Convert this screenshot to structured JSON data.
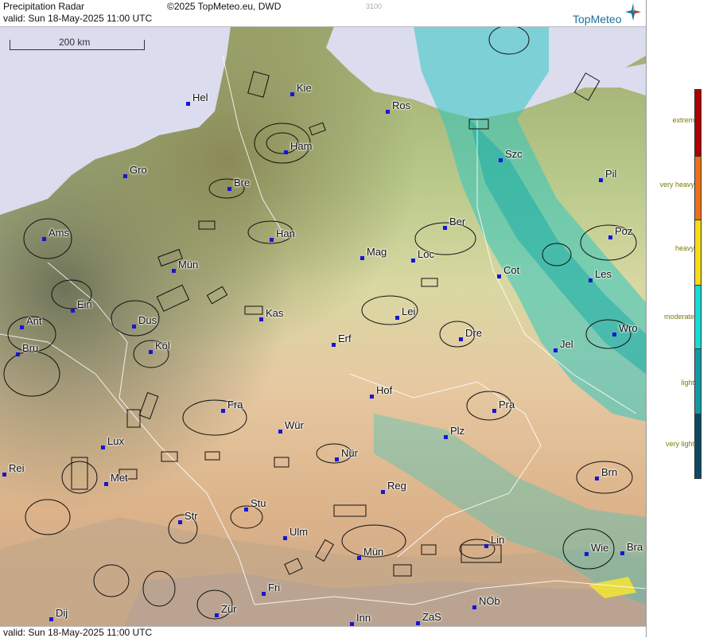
{
  "header": {
    "title": "Precipitation Radar",
    "copyright": "©2025 TopMeteo.eu, DWD",
    "code": "3100",
    "valid": "valid:  Sun  18-May-2025 11:00 UTC",
    "brand": "TopMeteo"
  },
  "footer": {
    "valid": "valid:  Sun  18-May-2025 11:00 UTC"
  },
  "scale": {
    "label": "200 km"
  },
  "legend": {
    "items": [
      {
        "label": "extrem",
        "color": "#b00000"
      },
      {
        "label": "very heavy",
        "color": "#ef7018"
      },
      {
        "label": "heavy",
        "color": "#f7dc14"
      },
      {
        "label": "moderate",
        "color": "#14dcd6"
      },
      {
        "label": "light",
        "color": "#119aa6"
      },
      {
        "label": "very light",
        "color": "#0c4a64"
      }
    ]
  },
  "cities": [
    {
      "name": "Hel"
    },
    {
      "name": "Kie"
    },
    {
      "name": "Ros"
    },
    {
      "name": "Ham"
    },
    {
      "name": "Gro"
    },
    {
      "name": "Bre"
    },
    {
      "name": "Szc"
    },
    {
      "name": "Pil"
    },
    {
      "name": "Ams"
    },
    {
      "name": "Han"
    },
    {
      "name": "Ber"
    },
    {
      "name": "Poz"
    },
    {
      "name": "Mün"
    },
    {
      "name": "Mag"
    },
    {
      "name": "Loc"
    },
    {
      "name": "Cot"
    },
    {
      "name": "Les"
    },
    {
      "name": "Ein"
    },
    {
      "name": "Kas"
    },
    {
      "name": "Lei"
    },
    {
      "name": "Ant"
    },
    {
      "name": "Dus"
    },
    {
      "name": "Dre"
    },
    {
      "name": "Wro"
    },
    {
      "name": "Bru"
    },
    {
      "name": "Köl"
    },
    {
      "name": "Erf"
    },
    {
      "name": "Jel"
    },
    {
      "name": "Hof"
    },
    {
      "name": "Fra"
    },
    {
      "name": "Pra"
    },
    {
      "name": "Wür"
    },
    {
      "name": "Plz"
    },
    {
      "name": "Lux"
    },
    {
      "name": "Nür"
    },
    {
      "name": "Rei"
    },
    {
      "name": "Met"
    },
    {
      "name": "Brn"
    },
    {
      "name": "Reg"
    },
    {
      "name": "Stu"
    },
    {
      "name": "Str"
    },
    {
      "name": "Ulm"
    },
    {
      "name": "Lin"
    },
    {
      "name": "Mün"
    },
    {
      "name": "Wie"
    },
    {
      "name": "Bra"
    },
    {
      "name": "Fri"
    },
    {
      "name": "Dij"
    },
    {
      "name": "Zür"
    },
    {
      "name": "NÖb"
    },
    {
      "name": "Inn"
    },
    {
      "name": "ZaS"
    }
  ]
}
